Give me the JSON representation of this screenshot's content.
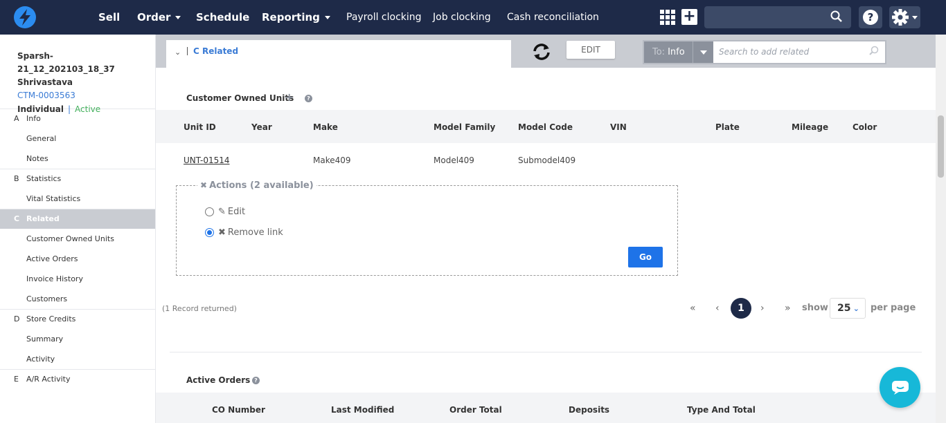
{
  "nav": {
    "items": [
      {
        "label": "Sell"
      },
      {
        "label": "Order"
      },
      {
        "label": "Schedule"
      },
      {
        "label": "Reporting"
      },
      {
        "label": "Payroll clocking"
      },
      {
        "label": "Job clocking"
      },
      {
        "label": "Cash reconciliation"
      }
    ],
    "help_label": "?"
  },
  "customer": {
    "name": "Sparsh-21_12_202103_18_37 Shrivastava",
    "id": "CTM-0003563",
    "type": "Individual",
    "separator": "|",
    "status": "Active"
  },
  "sidebar": {
    "sections": [
      {
        "letter": "A",
        "label": "Info",
        "items": [
          "General",
          "Notes"
        ]
      },
      {
        "letter": "B",
        "label": "Statistics",
        "items": [
          "Vital Statistics"
        ]
      },
      {
        "letter": "C",
        "label": "Related",
        "items": [
          "Customer Owned Units",
          "Active Orders",
          "Invoice History",
          "Customers"
        ]
      },
      {
        "letter": "D",
        "label": "Store Credits",
        "items": [
          "Summary",
          "Activity"
        ]
      },
      {
        "letter": "E",
        "label": "A/R Activity",
        "items": []
      }
    ]
  },
  "tabbar": {
    "bar": "|",
    "selected": "C Related",
    "edit_label": "EDIT",
    "to_prefix": "To:",
    "to_value": "Info",
    "search_placeholder": "Search to add related"
  },
  "units": {
    "title": "Customer Owned Units",
    "columns": [
      "Unit ID",
      "Year",
      "Make",
      "Model Family",
      "Model Code",
      "VIN",
      "Plate",
      "Mileage",
      "Color"
    ],
    "rows": [
      {
        "unit_id": "UNT-01514",
        "year": "",
        "make": "Make409",
        "model_family": "Model409",
        "model_code": "Submodel409",
        "vin": "",
        "plate": "",
        "mileage": "",
        "color": ""
      }
    ],
    "actions": {
      "legend": "Actions (2 available)",
      "options": [
        {
          "label": "Edit",
          "selected": false
        },
        {
          "label": "Remove link",
          "selected": true
        }
      ],
      "go_label": "Go"
    },
    "records": "(1 Record returned)",
    "pagination": {
      "current": "1",
      "show_label": "show",
      "per_page": "25",
      "per_page_label": "per page"
    }
  },
  "orders": {
    "title": "Active Orders",
    "columns": [
      "CO Number",
      "Last Modified",
      "Order Total",
      "Deposits",
      "Type And Total"
    ]
  },
  "colors": {
    "nav_bg": "#1e2a48",
    "accent": "#1e73e8",
    "link": "#3a7bd5",
    "active_green": "#43b05c",
    "chat": "#17b8d8"
  }
}
